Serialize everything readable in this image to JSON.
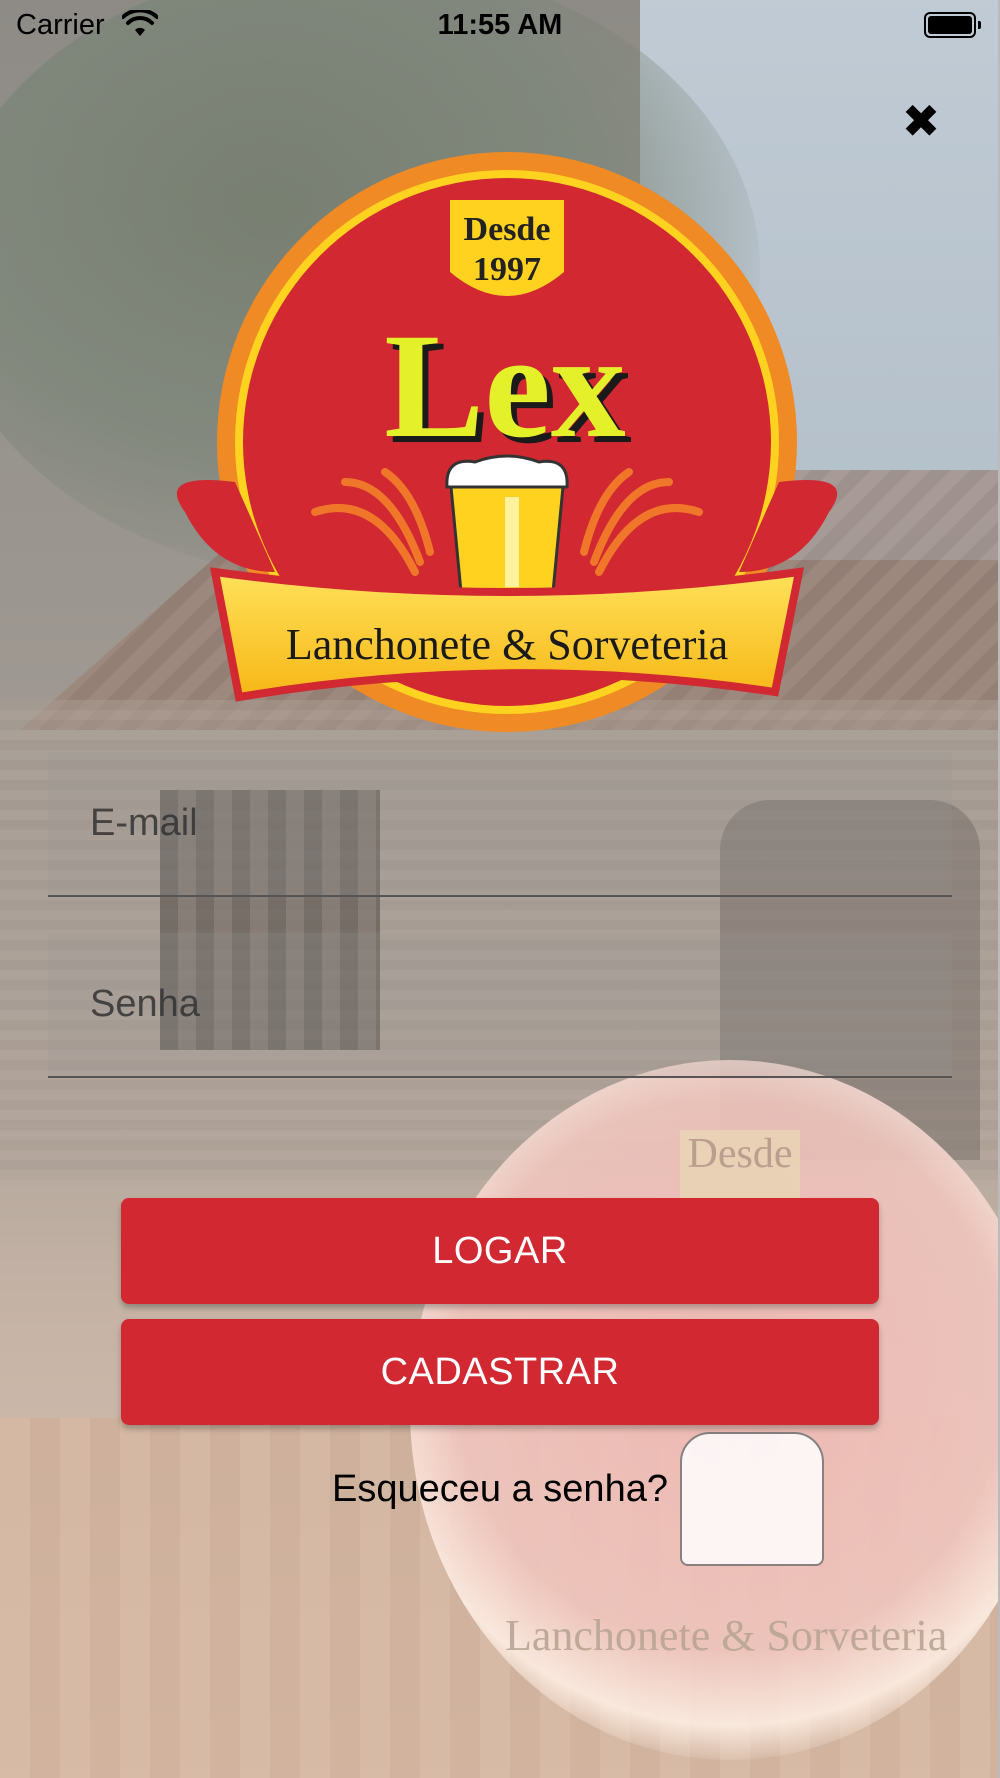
{
  "status_bar": {
    "carrier": "Carrier",
    "time": "11:55 AM"
  },
  "logo": {
    "badge_line1": "Desde",
    "badge_line2": "1997",
    "brand": "Lex",
    "tagline": "Lanchonete & Sorveteria",
    "colors": {
      "red": "#d12832",
      "orange": "#f08a24",
      "yellow": "#ffd21f"
    }
  },
  "background": {
    "ghost_badge": "Desde",
    "ghost_tagline": "Lanchonete & Sorveteria"
  },
  "form": {
    "email_placeholder": "E-mail",
    "password_placeholder": "Senha",
    "login_label": "LOGAR",
    "register_label": "CADASTRAR",
    "forgot_label": "Esqueceu a senha?"
  },
  "colors": {
    "button": "#d12832",
    "button_text": "#ffffff"
  },
  "icons": {
    "close": "close-icon",
    "wifi": "wifi-icon",
    "battery": "battery-icon"
  }
}
